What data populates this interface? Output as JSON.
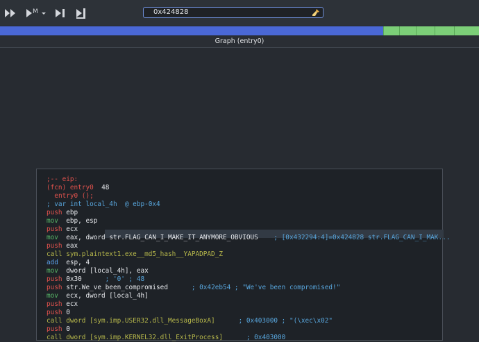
{
  "toolbar": {
    "address": "0x424828",
    "step_superscript": "M"
  },
  "progress": {
    "blue_fraction": 0.8,
    "segments": 5
  },
  "graph_title": "Graph (entry0)",
  "code": {
    "label_eip": ";-- eip:",
    "fcn_prefix": "(fcn)",
    "fcn_name": "entry0",
    "fcn_size": "48",
    "sig": "entry0 ();",
    "var_comment": "; var int local_4h  @ ebp-0x4",
    "lines": [
      {
        "mnem": "push",
        "ops": "ebp"
      },
      {
        "mnem": "mov",
        "ops": "ebp, esp"
      },
      {
        "mnem": "push",
        "ops": "ecx"
      },
      {
        "mnem": "mov",
        "ops": "eax, dword",
        "hl": "str.FLAG_CAN_I_MAKE_IT_ANYMORE_OBVIOUS",
        "comment": "; [0x432294:4]=0x424828 str.FLAG_CAN_I_MAK..."
      },
      {
        "mnem": "push",
        "ops": "eax"
      },
      {
        "mnem": "call",
        "ops": "sym.plaintext1.exe__md5_hash__YAPADPAD_Z"
      },
      {
        "mnem": "add",
        "ops": "esp, 4"
      },
      {
        "mnem": "mov",
        "ops": "dword [local_4h], eax"
      },
      {
        "mnem": "push",
        "ops": "0x30",
        "comment": "; '0' ; 48"
      },
      {
        "mnem": "push",
        "ops": "str.We_ve_been_compromised",
        "comment": "; 0x42eb54 ; \"We've been compromised!\""
      },
      {
        "mnem": "mov",
        "ops": "ecx, dword [local_4h]"
      },
      {
        "mnem": "push",
        "ops": "ecx"
      },
      {
        "mnem": "push",
        "ops": "0"
      },
      {
        "mnem": "call",
        "ops": "dword [sym.imp.USER32.dll_MessageBoxA]",
        "comment": "; 0x403000 ; \"(\\xec\\x02\""
      },
      {
        "mnem": "push",
        "ops": "0"
      },
      {
        "mnem": "call",
        "ops": "dword [sym.imp.KERNEL32.dll_ExitProcess]",
        "comment": "; 0x403000"
      }
    ]
  }
}
